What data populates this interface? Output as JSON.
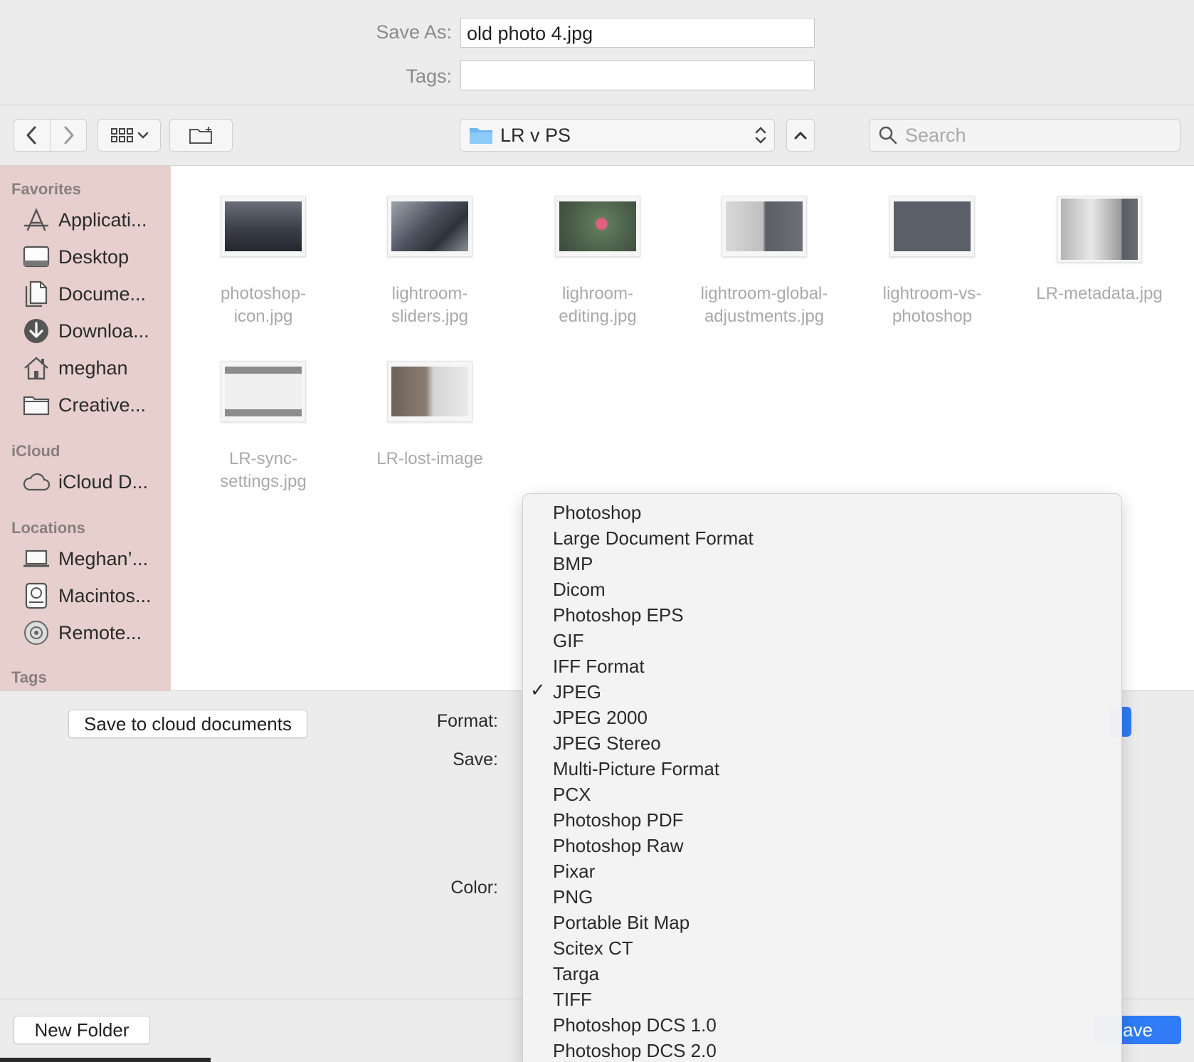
{
  "header": {
    "save_as_label": "Save As:",
    "save_as_value": "old photo 4.jpg",
    "tags_label": "Tags:",
    "tags_value": ""
  },
  "toolbar": {
    "location": "LR v PS",
    "search_placeholder": "Search"
  },
  "sidebar": {
    "favorites_label": "Favorites",
    "favorites": [
      {
        "label": "Applicati...",
        "icon": "applications-icon"
      },
      {
        "label": "Desktop",
        "icon": "desktop-icon"
      },
      {
        "label": "Docume...",
        "icon": "documents-icon"
      },
      {
        "label": "Downloa...",
        "icon": "downloads-icon"
      },
      {
        "label": "meghan",
        "icon": "home-icon"
      },
      {
        "label": "Creative...",
        "icon": "folder-icon"
      }
    ],
    "icloud_label": "iCloud",
    "icloud": [
      {
        "label": "iCloud D...",
        "icon": "cloud-icon"
      }
    ],
    "locations_label": "Locations",
    "locations": [
      {
        "label": "Meghan’...",
        "icon": "laptop-icon"
      },
      {
        "label": "Macintos...",
        "icon": "hard-drive-icon"
      },
      {
        "label": "Remote...",
        "icon": "disc-icon"
      }
    ],
    "tags_label": "Tags"
  },
  "files": [
    {
      "line1": "photoshop-",
      "line2": "icon.jpg"
    },
    {
      "line1": "lightroom-",
      "line2": "sliders.jpg"
    },
    {
      "line1": "lighroom-",
      "line2": "editing.jpg"
    },
    {
      "line1": "lightroom-global-",
      "line2": "adjustments.jpg"
    },
    {
      "line1": "lightroom-vs-",
      "line2": "photoshop"
    },
    {
      "line1": "LR-metadata.jpg",
      "line2": ""
    },
    {
      "line1": "LR-sync-",
      "line2": "settings.jpg"
    },
    {
      "line1": "LR-lost-image",
      "line2": ""
    }
  ],
  "bottom": {
    "cloud_button": "Save to cloud documents",
    "format_label": "Format:",
    "save_label": "Save:",
    "color_label": "Color:",
    "new_folder_button": "New Folder",
    "save_button_partial": "ave"
  },
  "format_menu": {
    "selected": "JPEG",
    "check_glyph": "✓",
    "items": [
      "Photoshop",
      "Large Document Format",
      "BMP",
      "Dicom",
      "Photoshop EPS",
      "GIF",
      "IFF Format",
      "JPEG",
      "JPEG 2000",
      "JPEG Stereo",
      "Multi-Picture Format",
      "PCX",
      "Photoshop PDF",
      "Photoshop Raw",
      "Pixar",
      "PNG",
      "Portable Bit Map",
      "Scitex CT",
      "Targa",
      "TIFF",
      "Photoshop DCS 1.0",
      "Photoshop DCS 2.0"
    ]
  },
  "colors": {
    "sidebar_bg": "#e6cfcc",
    "accent_blue": "#2f7cf6",
    "folder_blue": "#6fb6ef"
  }
}
